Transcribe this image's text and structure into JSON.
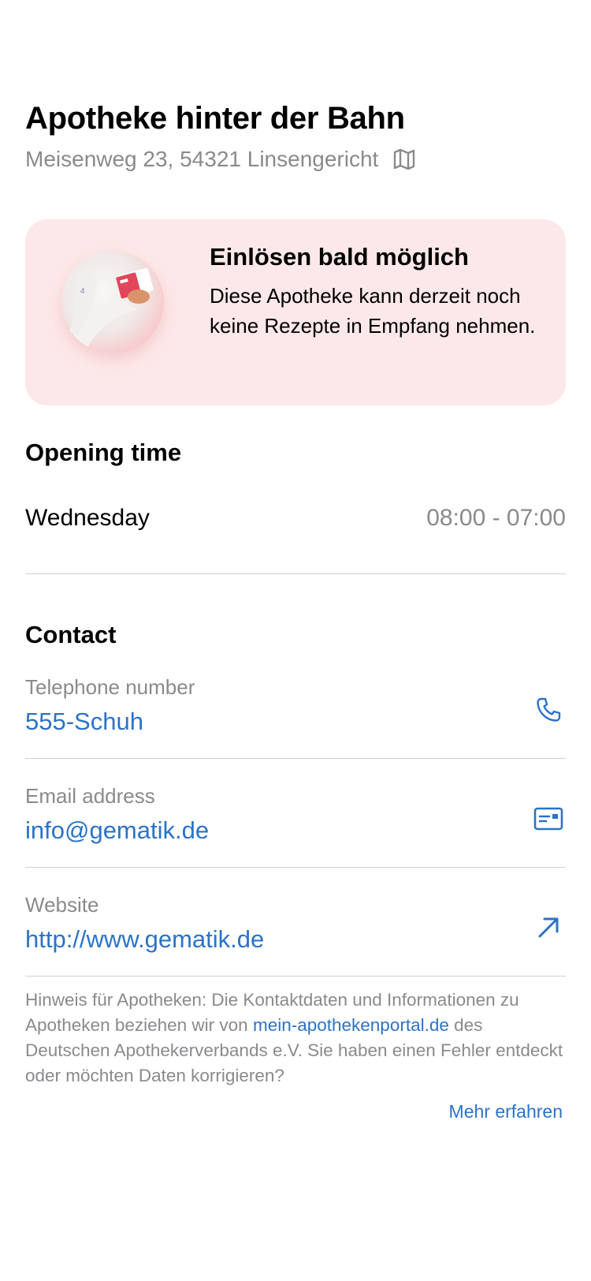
{
  "pharmacy": {
    "name": "Apotheke hinter der Bahn",
    "address": "Meisenweg 23, 54321 Linsengericht",
    "map_icon": "map-icon"
  },
  "banner": {
    "title": "Einlösen bald möglich",
    "body": "Diese Apotheke kann derzeit noch keine Rezepte in Empfang nehmen.",
    "background": "#fde8e9"
  },
  "opening": {
    "heading": "Opening time",
    "rows": [
      {
        "day": "Wednesday",
        "hours": "08:00 - 07:00"
      }
    ]
  },
  "contact": {
    "heading": "Contact",
    "items": [
      {
        "label": "Telephone number",
        "value": "555-Schuh",
        "icon": "phone-icon"
      },
      {
        "label": "Email address",
        "value": "info@gematik.de",
        "icon": "mail-card-icon"
      },
      {
        "label": "Website",
        "value": "http://www.gematik.de",
        "icon": "arrow-up-right-icon"
      }
    ]
  },
  "note": {
    "text_before": "Hinweis für Apotheken: Die Kontaktdaten und Informationen zu Apotheken beziehen wir von ",
    "link": "mein-apothekenportal.de",
    "text_after": " des Deutschen Apothekerverbands e.V. Sie haben einen Fehler entdeckt oder möchten Daten korrigieren?",
    "more_link": "Mehr erfahren"
  },
  "colors": {
    "accent": "#2b73c7",
    "secondary_text": "#8a8a8e",
    "divider": "#d1d1d6"
  }
}
